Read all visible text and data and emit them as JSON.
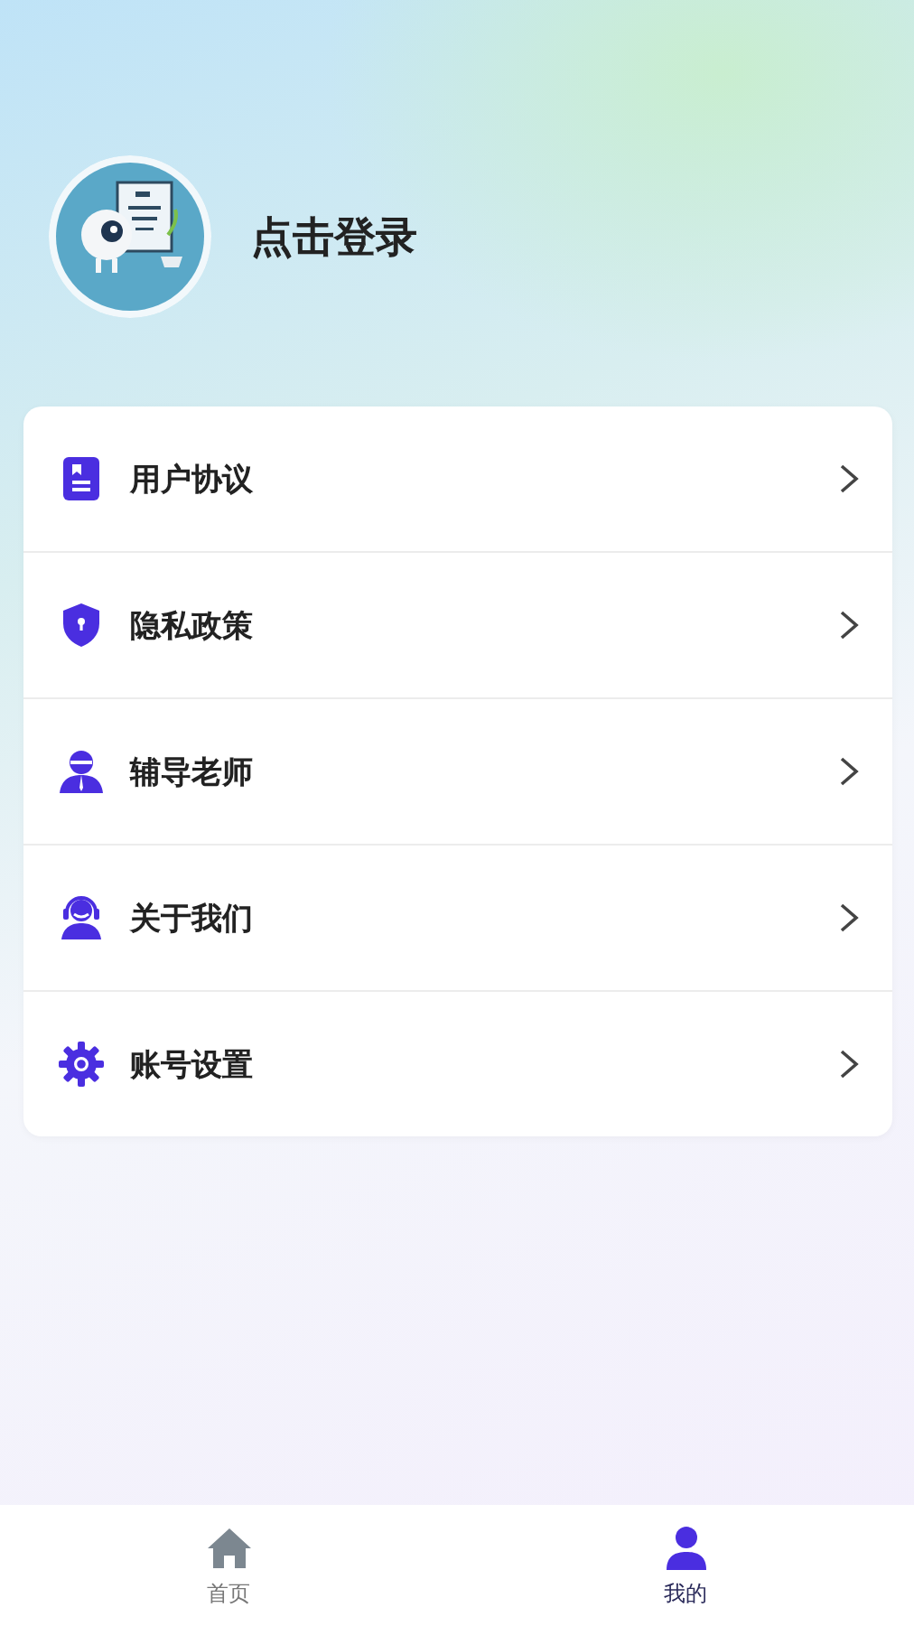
{
  "profile": {
    "login_label": "点击登录"
  },
  "menu": [
    {
      "kind": "document",
      "label": "用户协议"
    },
    {
      "kind": "shield",
      "label": "隐私政策"
    },
    {
      "kind": "teacher",
      "label": "辅导老师"
    },
    {
      "kind": "support",
      "label": "关于我们"
    },
    {
      "kind": "gear",
      "label": "账号设置"
    }
  ],
  "tab_bar": [
    {
      "kind": "home",
      "label": "首页",
      "selected": false
    },
    {
      "kind": "user",
      "label": "我的",
      "selected": true
    }
  ]
}
